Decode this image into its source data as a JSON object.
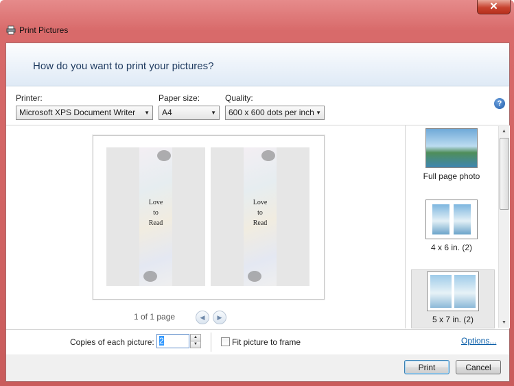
{
  "window": {
    "title": "Print Pictures",
    "close_symbol": "✕"
  },
  "header": {
    "question": "How do you want to print your pictures?"
  },
  "options": {
    "printer_label": "Printer:",
    "printer_value": "Microsoft XPS Document Writer",
    "paper_label": "Paper size:",
    "paper_value": "A4",
    "quality_label": "Quality:",
    "quality_value": "600 x 600 dots per inch",
    "help_symbol": "?"
  },
  "preview": {
    "pager_text": "1 of 1 page",
    "bookmark_lines": [
      "Love",
      "to",
      "Read"
    ],
    "prev_icon": "◀",
    "next_icon": "▶"
  },
  "layouts": [
    {
      "label": "Full page photo"
    },
    {
      "label": "4 x 6 in. (2)"
    },
    {
      "label": "5 x 7 in. (2)"
    }
  ],
  "bottom": {
    "copies_label": "Copies of each picture:",
    "copies_value": "2",
    "fit_label": "Fit picture to frame",
    "fit_checked": false,
    "options_link": "Options..."
  },
  "buttons": {
    "print": "Print",
    "cancel": "Cancel"
  },
  "colors": {
    "accent": "#3399ff",
    "link": "#0a5ea8",
    "header_text": "#1e3a5f"
  }
}
